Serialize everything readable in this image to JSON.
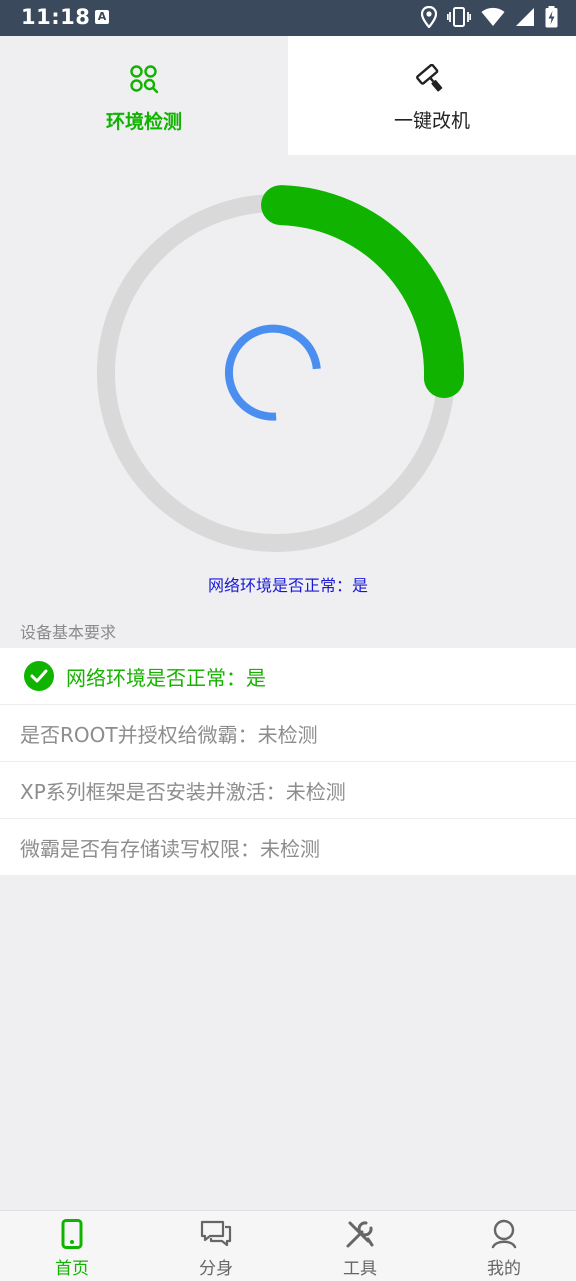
{
  "status_bar": {
    "time": "11:18",
    "a_badge": "A"
  },
  "tabs": [
    {
      "label": "环境检测",
      "icon": "grid-search-icon",
      "active": true
    },
    {
      "label": "一键改机",
      "icon": "paint-roller-icon",
      "active": false
    }
  ],
  "gauge": {
    "progress": 0.25,
    "accent": "#0fb300",
    "track": "#d9d9d9",
    "spinner": "#4a8ef0"
  },
  "network_status": "网络环境是否正常：是",
  "section_title": "设备基本要求",
  "requirements": [
    {
      "text": "网络环境是否正常：是",
      "passed": true
    },
    {
      "text": "是否ROOT并授权给微霸：未检测",
      "passed": false
    },
    {
      "text": "XP系列框架是否安装并激活：未检测",
      "passed": false
    },
    {
      "text": "微霸是否有存储读写权限：未检测",
      "passed": false
    }
  ],
  "bottom_nav": [
    {
      "label": "首页",
      "icon": "phone-icon",
      "active": true
    },
    {
      "label": "分身",
      "icon": "chat-icon",
      "active": false
    },
    {
      "label": "工具",
      "icon": "tools-icon",
      "active": false
    },
    {
      "label": "我的",
      "icon": "user-icon",
      "active": false
    }
  ],
  "colors": {
    "brand": "#10b300",
    "link_blue": "#1a1ad6"
  }
}
